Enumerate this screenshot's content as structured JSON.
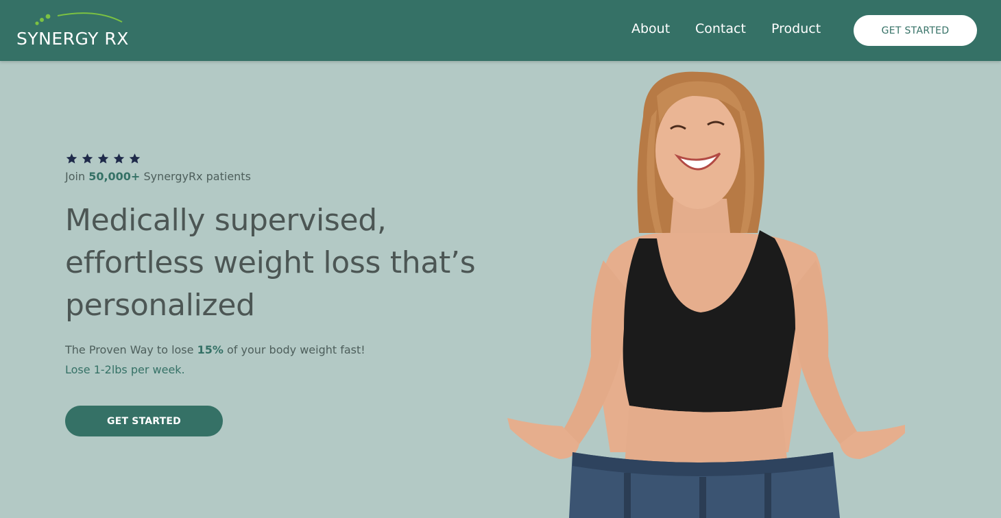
{
  "header": {
    "logo_text": "SYNERGY RX",
    "nav": [
      {
        "label": "About"
      },
      {
        "label": "Contact"
      },
      {
        "label": "Product"
      }
    ],
    "cta_label": "GET STARTED"
  },
  "hero": {
    "rating_stars": 5,
    "join_prefix": "Join",
    "join_count": "50,000+",
    "join_suffix": "SynergyRx patients",
    "headline_lines": [
      "Medically supervised,",
      "effortless weight loss that’s",
      "personalized"
    ],
    "sub_prefix": "The Proven Way to lose",
    "sub_percent": "15%",
    "sub_suffix": "of your body weight fast!",
    "sub_highlight": "Lose 1-2lbs per week.",
    "cta_label": "GET STARTED"
  },
  "colors": {
    "brand_green": "#357166",
    "background": "#b3c9c5",
    "star_navy": "#1f2a4a",
    "logo_accent": "#7cc242"
  }
}
